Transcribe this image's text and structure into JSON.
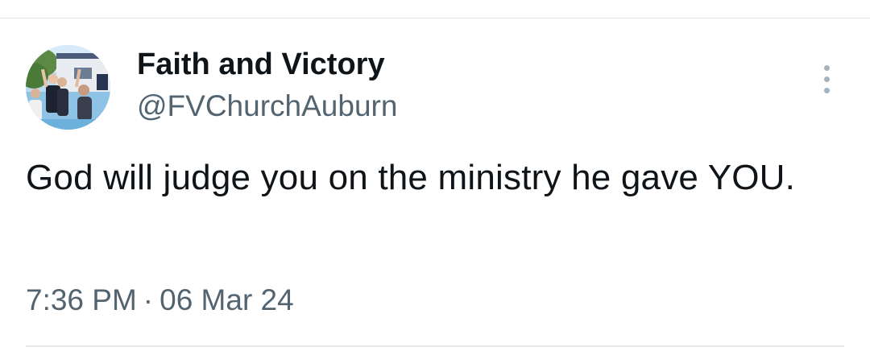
{
  "tweet": {
    "author": {
      "display_name": "Faith and Victory",
      "handle": "@FVChurchAuburn",
      "avatar_icon": "profile-photo"
    },
    "more_icon": "more-vertical-icon",
    "text": "God will judge you on the ministry he gave YOU.",
    "time": "7:36 PM",
    "separator": "·",
    "date": "06 Mar 24"
  },
  "colors": {
    "text_primary": "#0f1419",
    "text_secondary": "#536471",
    "divider": "#e6e9eb",
    "more_icon": "#a4b2bd"
  }
}
